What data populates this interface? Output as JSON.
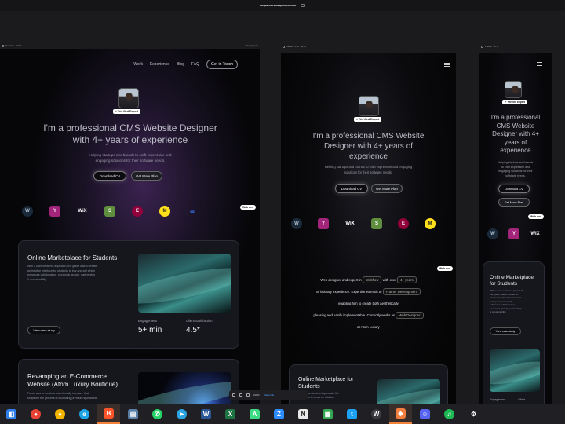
{
  "window": {
    "title": "Responsive Breakpoint Preview",
    "subtitle": "webflow.io · 3 breakpoints"
  },
  "frames": {
    "desktop": {
      "label": "Desktop · 1440",
      "zoom": "Breakpoints"
    },
    "tablet": {
      "label": "Tablet · 834 · 1194"
    },
    "mobile": {
      "label": "Phone · 375"
    }
  },
  "nav": {
    "items": [
      "Work",
      "Experience",
      "Blog",
      "FAQ"
    ],
    "cta": "Get in Touch"
  },
  "badge": "Verified Expert",
  "hero": {
    "title_line1": "I'm a professional CMS Website Designer",
    "title_line2": "with 4+ years of experience",
    "tablet_title_line1": "I'm a professional CMS Website",
    "tablet_title_line2": "Designer with 4+ years of",
    "tablet_title_line3": "experience",
    "mobile_title_line1": "I'm a professional",
    "mobile_title_line2": "CMS Website",
    "mobile_title_line3": "Designer with 4+",
    "mobile_title_line4": "years of",
    "mobile_title_line5": "experience",
    "sub_line1": "Helping startups and brands to craft expressive and",
    "sub_line2": "engaging solutions for their software needs.",
    "tablet_sub_line1": "Helping startups and brands to craft expressive and engaging",
    "tablet_sub_line2": "solutions for their software needs.",
    "mobile_sub_line1": "Helping startups and brands",
    "mobile_sub_line2": "to craft expressive and",
    "mobile_sub_line3": "engaging solutions for their",
    "mobile_sub_line4": "software needs.",
    "btn_cv": "Download CV",
    "btn_hire": "Get More Plan"
  },
  "logos": [
    {
      "icon": "wordpress-icon",
      "glyph": "W"
    },
    {
      "icon": "yoast-icon",
      "glyph": "Y"
    },
    {
      "icon": "wix-icon",
      "glyph": "WiX"
    },
    {
      "icon": "shopify-icon",
      "glyph": "S"
    },
    {
      "icon": "elementor-icon",
      "glyph": "E"
    },
    {
      "icon": "mailchimp-icon",
      "glyph": "M"
    },
    {
      "icon": "meta-icon",
      "glyph": "∞"
    }
  ],
  "pill": "Web dev",
  "about": {
    "line1a": "Web designer and expert in",
    "chip1": "Webflow",
    "line1b": "with over",
    "chip2": "4+ years",
    "line2a": "of industry experience.",
    "line2b": "Expertise extends to",
    "chip3": "Framer Development",
    "line3": "enabling him to create   both aesthetically",
    "line4a": "pleasing and easily implementable.",
    "line4b": "Currently works as",
    "chip4": "Web Designer",
    "line5": "at Atom Luxury"
  },
  "case1": {
    "title": "Online Marketplace for Students",
    "desc1": "With a user-centered approach, the guide was to create",
    "desc2": "an intuitive interface for students to buy and sell which",
    "desc3": "enhances collaboration, economic growth, partnership",
    "desc4": "& sustainability.",
    "btn": "View case study",
    "stat1_label": "Engagement",
    "stat1_value": "5+ min",
    "stat2_label": "Client Satisfaction",
    "stat2_value": "4.5*"
  },
  "case2": {
    "title_line1": "Revamping an E-Commerce",
    "title_line2": "Website (Atom Luxury Boutique)",
    "desc1": "Focus was to create a user-friendly interface that",
    "desc2": "simplified the process of accessing premium sportswear"
  },
  "tablet_case": {
    "title_line1": "Online Marketplace for",
    "title_line2": "Students",
    "desc1": "With a user-centered approach, the",
    "desc2": "guide was to create an intuitive"
  },
  "mobile_case": {
    "title_line1": "Online Marketplace",
    "title_line2": "for Students",
    "desc1": "With a user-centered approach,",
    "desc2": "the guide was to create an",
    "desc3": "intuitive interface for students",
    "desc4": "to buy and sell which",
    "desc5": "enhances collaboration,",
    "desc6": "economic growth, partnership",
    "desc7": "& sustainability.",
    "btn": "View case study",
    "stat1_label": "Engagement",
    "stat2_label": "Client"
  },
  "zoombar": {
    "value": "100%",
    "label": "Share link"
  },
  "taskbar": [
    {
      "name": "vscode-icon",
      "color": "#2f80ed",
      "glyph": "◧"
    },
    {
      "name": "chrome-icon",
      "color": "#e84335",
      "glyph": "●"
    },
    {
      "name": "chrome-canary-icon",
      "color": "#f5b400",
      "glyph": "●"
    },
    {
      "name": "edge-icon",
      "color": "#1ea4e9",
      "glyph": "e"
    },
    {
      "name": "brave-icon",
      "color": "#fb542b",
      "glyph": "B"
    },
    {
      "name": "notepad-icon",
      "color": "#5a7fa6",
      "glyph": "▤"
    },
    {
      "name": "whatsapp-icon",
      "color": "#25d366",
      "glyph": "✆"
    },
    {
      "name": "telegram-icon",
      "color": "#2aa3e0",
      "glyph": "➤"
    },
    {
      "name": "word-icon",
      "color": "#2b5797",
      "glyph": "W"
    },
    {
      "name": "excel-icon",
      "color": "#1f7244",
      "glyph": "X"
    },
    {
      "name": "android-studio-icon",
      "color": "#3ddc84",
      "glyph": "A"
    },
    {
      "name": "zoom-icon",
      "color": "#2d8cff",
      "glyph": "Z"
    },
    {
      "name": "notion-icon",
      "color": "#e8e8e8",
      "glyph": "N"
    },
    {
      "name": "sheets-icon",
      "color": "#34a853",
      "glyph": "▦"
    },
    {
      "name": "twitter-icon",
      "color": "#1da1f2",
      "glyph": "t"
    },
    {
      "name": "webflow-icon",
      "color": "#3a3a3f",
      "glyph": "W"
    },
    {
      "name": "figma-icon",
      "color": "#f27e3f",
      "glyph": "◆"
    },
    {
      "name": "discord-icon",
      "color": "#5865f2",
      "glyph": "☺"
    },
    {
      "name": "spotify-icon",
      "color": "#1db954",
      "glyph": "♫"
    },
    {
      "name": "settings-icon",
      "color": "#4a4a52",
      "glyph": "⚙"
    }
  ]
}
